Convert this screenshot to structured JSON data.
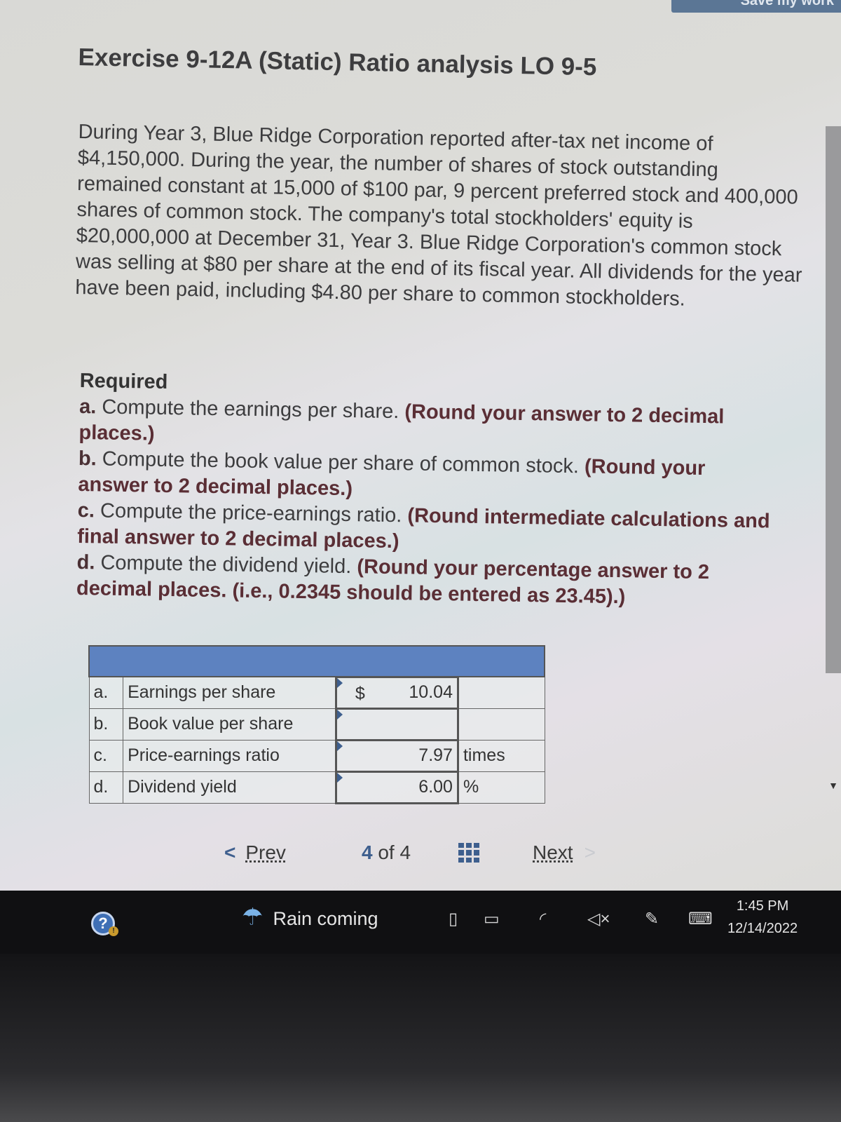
{
  "header": {
    "top_button_label": "Save my work",
    "title": "Exercise 9-12A (Static) Ratio analysis LO 9-5"
  },
  "problem_text": "During Year 3, Blue Ridge Corporation reported after-tax net income of $4,150,000. During the year, the number of shares of stock outstanding remained constant at 15,000 of $100 par, 9 percent preferred stock and 400,000 shares of common stock. The company's total stockholders' equity is $20,000,000 at December 31, Year 3. Blue Ridge Corporation's common stock was selling at $80 per share at the end of its fiscal year. All dividends for the year have been paid, including $4.80 per share to common stockholders.",
  "required": {
    "heading": "Required",
    "items": [
      {
        "label": "a.",
        "text": " Compute the earnings per share. ",
        "note": "(Round your answer to 2 decimal places.)"
      },
      {
        "label": "b.",
        "text": " Compute the book value per share of common stock. ",
        "note": "(Round your answer to 2 decimal places.)"
      },
      {
        "label": "c.",
        "text": " Compute the price-earnings ratio. ",
        "note": "(Round intermediate calculations and final answer to 2 decimal places.)"
      },
      {
        "label": "d.",
        "text": " Compute the dividend yield. ",
        "note": "(Round your percentage answer to 2 decimal places. (i.e., 0.2345 should be entered as 23.45).)"
      }
    ]
  },
  "answer_table": {
    "rows": [
      {
        "letter": "a.",
        "label": "Earnings per share",
        "currency": "$",
        "value": "10.04",
        "unit": ""
      },
      {
        "letter": "b.",
        "label": "Book value per share",
        "currency": "",
        "value": "",
        "unit": ""
      },
      {
        "letter": "c.",
        "label": "Price-earnings ratio",
        "currency": "",
        "value": "7.97",
        "unit": "times"
      },
      {
        "letter": "d.",
        "label": "Dividend yield",
        "currency": "",
        "value": "6.00",
        "unit": "%"
      }
    ]
  },
  "navigation": {
    "prev_label": "Prev",
    "current_page": "4",
    "of_label": "of",
    "total_pages": "4",
    "next_label": "Next"
  },
  "taskbar": {
    "weather_text": "Rain coming",
    "time": "1:45 PM",
    "date": "12/14/2022"
  },
  "colors": {
    "accent": "#3e5f8e",
    "table_header": "#5d82c0",
    "note_text": "#5a2e35"
  }
}
